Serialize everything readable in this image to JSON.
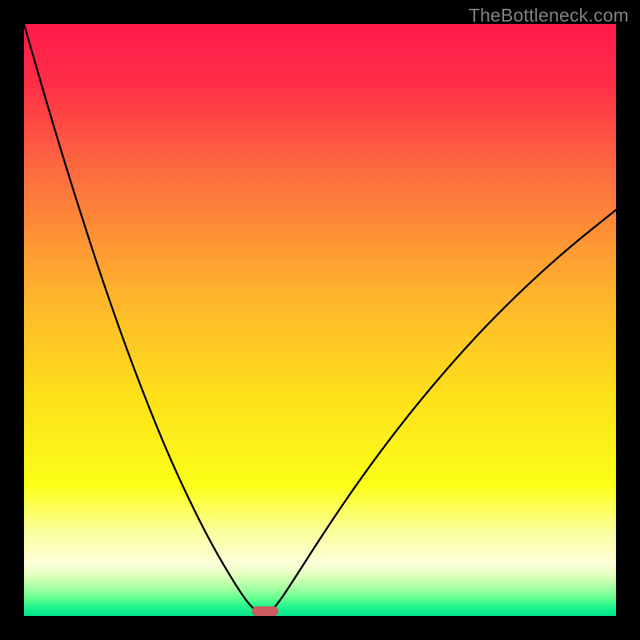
{
  "watermark": {
    "text": "TheBottleneck.com"
  },
  "chart_data": {
    "type": "line",
    "title": "",
    "xlabel": "",
    "ylabel": "",
    "xlim": [
      0,
      100
    ],
    "ylim": [
      0,
      100
    ],
    "gradient_stops": [
      {
        "offset": 0.0,
        "color": "#ff1a4b"
      },
      {
        "offset": 0.1,
        "color": "#ff2e47"
      },
      {
        "offset": 0.25,
        "color": "#fd6c3f"
      },
      {
        "offset": 0.45,
        "color": "#feb22d"
      },
      {
        "offset": 0.62,
        "color": "#fede1b"
      },
      {
        "offset": 0.78,
        "color": "#fbff18"
      },
      {
        "offset": 0.86,
        "color": "#fbffa0"
      },
      {
        "offset": 0.912,
        "color": "#fdffd9"
      },
      {
        "offset": 0.928,
        "color": "#e6ffc0"
      },
      {
        "offset": 0.942,
        "color": "#c5ffb0"
      },
      {
        "offset": 0.956,
        "color": "#9bff9e"
      },
      {
        "offset": 0.97,
        "color": "#64ff90"
      },
      {
        "offset": 0.985,
        "color": "#20f58d"
      },
      {
        "offset": 1.0,
        "color": "#00e38b"
      }
    ],
    "series": [
      {
        "name": "bottleneck-curve",
        "x": [
          0.0,
          2.5,
          5.0,
          7.5,
          10.0,
          12.5,
          15.0,
          17.5,
          20.0,
          22.5,
          25.0,
          27.5,
          30.0,
          32.5,
          35.0,
          36.5,
          38.0,
          39.5,
          41.0,
          43.0,
          46.0,
          49.0,
          53.0,
          58.0,
          64.0,
          71.0,
          78.0,
          85.0,
          92.0,
          100.0
        ],
        "y": [
          100.0,
          91.3,
          82.8,
          74.6,
          66.7,
          59.0,
          51.7,
          44.7,
          38.1,
          31.8,
          25.9,
          20.5,
          15.4,
          10.7,
          6.5,
          4.1,
          2.0,
          0.6,
          0.0,
          2.2,
          6.8,
          11.5,
          17.6,
          24.8,
          32.8,
          41.3,
          49.0,
          55.9,
          62.2,
          68.6
        ]
      }
    ],
    "marker": {
      "x_start": 38.5,
      "x_end": 43.0,
      "color": "#cb5b5d"
    }
  }
}
